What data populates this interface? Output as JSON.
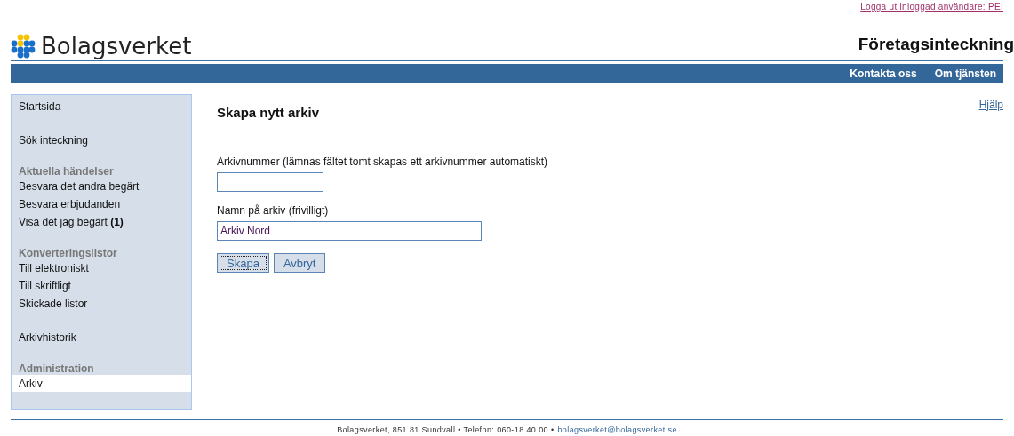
{
  "header": {
    "logout_link": "Logga ut inloggad användare: PEI",
    "logo_text": "Bolagsverket",
    "service_title": "Företagsinteckning"
  },
  "nav": [
    "Kontakta oss",
    "Om tjänsten"
  ],
  "sidebar": {
    "sections": [
      {
        "items": [
          {
            "label": "Startsida",
            "selected": false
          }
        ]
      },
      {
        "items": [
          {
            "label": "Sök inteckning",
            "selected": false
          }
        ]
      },
      {
        "heading": "Aktuella händelser",
        "items": [
          {
            "label": "Besvara det andra begärt",
            "selected": false
          },
          {
            "label": "Besvara erbjudanden",
            "selected": false
          },
          {
            "label": "Visa det jag begärt **(1)**",
            "selected": false
          }
        ]
      },
      {
        "heading": "Konverteringslistor",
        "items": [
          {
            "label": "Till elektroniskt",
            "selected": false
          },
          {
            "label": "Till skriftligt",
            "selected": false
          },
          {
            "label": "Skickade listor",
            "selected": false
          }
        ]
      },
      {
        "items": [
          {
            "label": "Arkivhistorik",
            "selected": false
          }
        ]
      },
      {
        "heading": "Administration",
        "items": [
          {
            "label": "Arkiv",
            "selected": true
          }
        ]
      }
    ]
  },
  "content": {
    "title": "Skapa nytt arkiv",
    "help_link": "Hjälp",
    "fields": [
      {
        "label": "Arkivnummer (lämnas fältet tomt skapas ett arkivnummer automatiskt)",
        "kind": "short"
      },
      {
        "label": "Namn på arkiv (frivilligt)",
        "value": "Arkiv Nord",
        "kind": "long"
      }
    ],
    "buttons": [
      {
        "label": "Skapa",
        "focused": true
      },
      {
        "label": "Avbryt",
        "focused": false
      }
    ]
  },
  "footer": {
    "text": "Bolagsverket, 851 81 Sundvall • Telefon: 060-18 40 00 •",
    "email": "bolagsverket@bolagsverket.se"
  }
}
